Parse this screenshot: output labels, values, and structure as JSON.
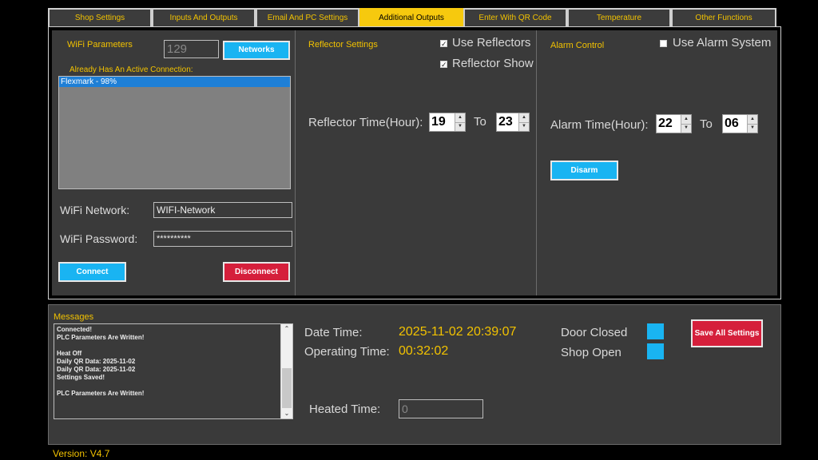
{
  "tabs": [
    {
      "label": "Shop Settings",
      "active": false
    },
    {
      "label": "Inputs And Outputs",
      "active": false
    },
    {
      "label": "Email And PC Settings",
      "active": false
    },
    {
      "label": "Additional Outputs",
      "active": true
    },
    {
      "label": "Enter With QR Code",
      "active": false
    },
    {
      "label": "Temperature",
      "active": false
    },
    {
      "label": "Other Functions",
      "active": false
    }
  ],
  "wifi": {
    "title": "WiFi Parameters",
    "count_value": "129",
    "networks_button": "Networks",
    "active_connection_label": "Already Has An Active Connection:",
    "connections": [
      "Flexmark - 98%"
    ],
    "network_label": "WiFi Network:",
    "network_value": "WIFI-Network",
    "password_label": "WiFi Password:",
    "password_value": "**********",
    "connect_button": "Connect",
    "disconnect_button": "Disconnect"
  },
  "reflector": {
    "title": "Reflector Settings",
    "use_label": "Use Reflectors",
    "use_checked": true,
    "show_label": "Reflector Show",
    "show_checked": true,
    "time_label": "Reflector Time(Hour):",
    "from": "19",
    "to_label": "To",
    "to": "23"
  },
  "alarm": {
    "title": "Alarm Control",
    "use_label": "Use Alarm System",
    "use_checked": false,
    "time_label": "Alarm Time(Hour):",
    "from": "22",
    "to_label": "To",
    "to": "06",
    "disarm_button": "Disarm"
  },
  "messages": {
    "title": "Messages",
    "lines": [
      "Connected!",
      "PLC Parameters Are Written!",
      "",
      "Heat Off",
      "Daily QR Data: 2025-11-02",
      "Daily QR Data: 2025-11-02",
      "Settings Saved!",
      "",
      "PLC Parameters Are Written!"
    ]
  },
  "status": {
    "datetime_label": "Date  Time:",
    "datetime_value": "2025-11-02 20:39:07",
    "operating_label": "Operating Time:",
    "operating_value": "00:32:02",
    "door_label": "Door Closed",
    "shop_label": "Shop Open",
    "heated_label": "Heated Time:",
    "heated_value": "0",
    "save_button": "Save All Settings"
  },
  "version": "Version: V4.7",
  "colors": {
    "accent_yellow": "#f2c200",
    "button_cyan": "#19b4f2",
    "button_red": "#d51f3b",
    "panel": "#3a3a3a"
  }
}
